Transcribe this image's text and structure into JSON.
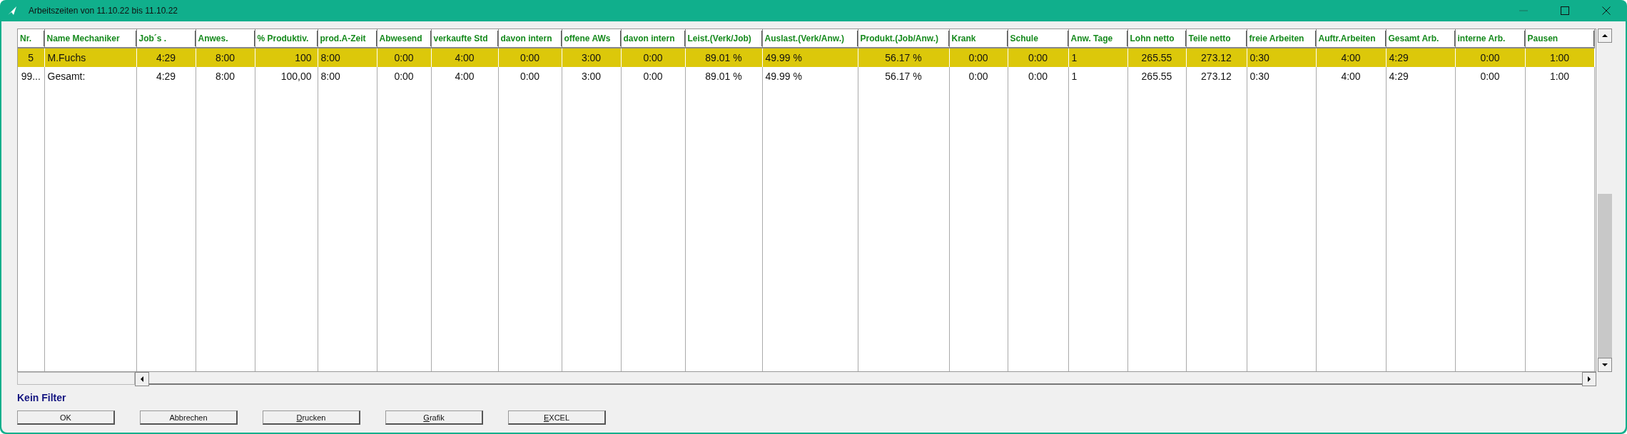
{
  "window": {
    "title": "Arbeitszeiten von 11.10.22 bis 11.10.22"
  },
  "table": {
    "columns": [
      "Nr.",
      "Name Mechaniker",
      "Job´s .",
      "Anwes.",
      "% Produktiv.",
      "prod.A-Zeit",
      "Abwesend",
      "verkaufte Std",
      "davon intern",
      "offene AWs",
      "davon intern",
      "Leist.(Verk/Job)",
      "Auslast.(Verk/Anw.)",
      "Produkt.(Job/Anw.)",
      "Krank",
      "Schule",
      "Anw. Tage",
      "Lohn netto",
      "Teile netto",
      "freie Arbeiten",
      "Auftr.Arbeiten",
      "Gesamt Arb.",
      "interne Arb.",
      "Pausen"
    ],
    "rows": [
      {
        "selected": true,
        "cells": [
          "5",
          "M.Fuchs",
          "4:29",
          "8:00",
          "100",
          "8:00",
          "0:00",
          "4:00",
          "0:00",
          "3:00",
          "0:00",
          "89.01 %",
          "49.99 %",
          "56.17 %",
          "0:00",
          "0:00",
          "1",
          "265.55",
          "273.12",
          "0:30",
          "4:00",
          "4:29",
          "0:00",
          "1:00"
        ]
      },
      {
        "selected": false,
        "cells": [
          "99...",
          "Gesamt:",
          "4:29",
          "8:00",
          "100,00",
          "8:00",
          "0:00",
          "4:00",
          "0:00",
          "3:00",
          "0:00",
          "89.01 %",
          "49.99 %",
          "56.17 %",
          "0:00",
          "0:00",
          "1",
          "265.55",
          "273.12",
          "0:30",
          "4:00",
          "4:29",
          "0:00",
          "1:00"
        ]
      }
    ]
  },
  "filter_label": "Kein Filter",
  "buttons": [
    {
      "label": "OK",
      "first_letter_underlined": false
    },
    {
      "label": "Abbrechen",
      "first_letter_underlined": false
    },
    {
      "label": "Drucken",
      "first_letter_underlined": true
    },
    {
      "label": "Grafik",
      "first_letter_underlined": true
    },
    {
      "label": "EXCEL",
      "first_letter_underlined": true
    }
  ]
}
